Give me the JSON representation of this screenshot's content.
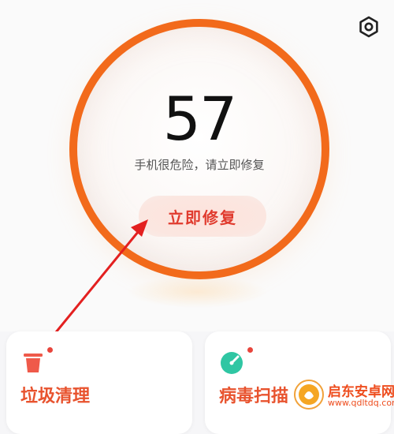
{
  "header": {
    "settings_icon": "hexagon-gear-icon"
  },
  "score": {
    "value": "57",
    "status": "手机很危险，请立即修复",
    "fix_button_label": "立即修复"
  },
  "colors": {
    "ring": "#f26a1b",
    "accent_red": "#e03b2e",
    "card_title": "#e8532e"
  },
  "cards": [
    {
      "title": "垃圾清理",
      "icon": "trash-can-icon",
      "icon_color": "#ef5a4a"
    },
    {
      "title": "病毒扫描",
      "icon": "virus-scan-icon",
      "icon_color": "#2fc6a3"
    }
  ],
  "watermark": {
    "text": "启东安卓网",
    "url": "www.qdltdq.com"
  }
}
